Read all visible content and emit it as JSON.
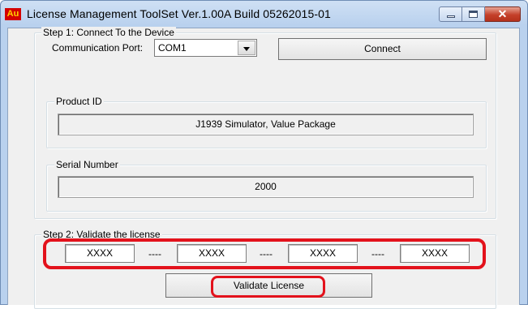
{
  "window": {
    "title": "License Management ToolSet Ver.1.00A Build 05262015-01",
    "icon_text": "Au",
    "controls": {
      "minimize": "minimize",
      "maximize": "maximize",
      "close": "✕"
    }
  },
  "step1": {
    "group_label": "Step 1: Connect To the Device",
    "port_label": "Communication Port:",
    "port_value": "COM1",
    "connect_label": "Connect",
    "product_id_label": "Product ID",
    "product_id_value": "J1939 Simulator, Value Package",
    "serial_label": "Serial Number",
    "serial_value": "2000"
  },
  "step2": {
    "group_label": "Step 2: Validate the license",
    "key_parts": [
      "XXXX",
      "XXXX",
      "XXXX",
      "XXXX"
    ],
    "separators": [
      "----",
      "----",
      "----"
    ],
    "validate_label": "Validate License"
  },
  "colors": {
    "highlight": "#e3121c",
    "title_gradient_top": "#cfe0f4",
    "close_button": "#c4402a"
  }
}
